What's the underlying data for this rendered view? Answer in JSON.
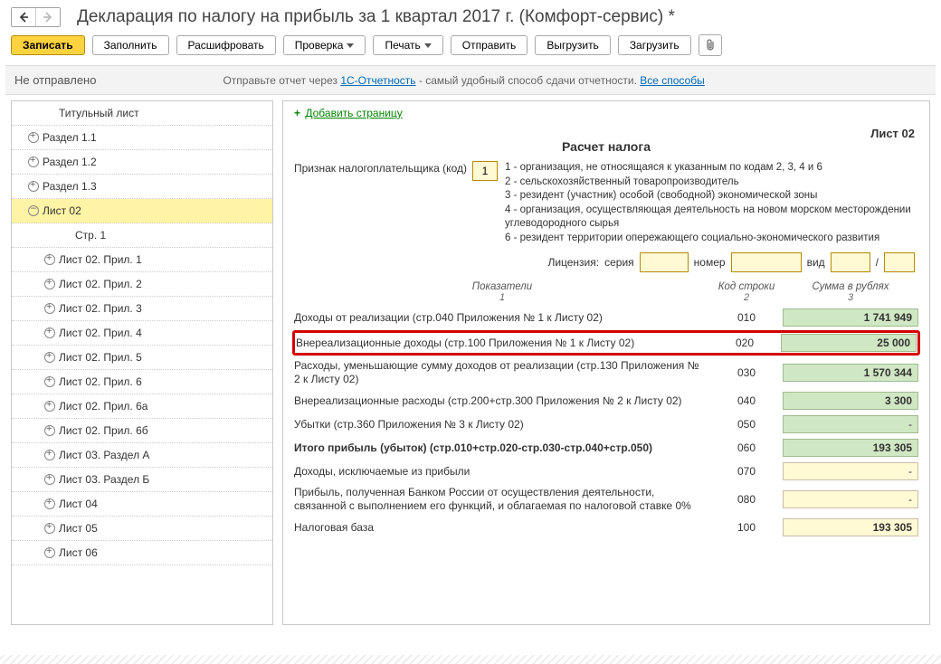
{
  "header": {
    "title": "Декларация по налогу на прибыль за 1 квартал 2017 г. (Комфорт-сервис) *"
  },
  "toolbar": {
    "primary": "Записать",
    "fill": "Заполнить",
    "decode": "Расшифровать",
    "check": "Проверка",
    "print": "Печать",
    "send": "Отправить",
    "export": "Выгрузить",
    "import": "Загрузить"
  },
  "status": {
    "label": "Не отправлено",
    "hint_pre": "Отправьте отчет через ",
    "hint_link1": "1С-Отчетность",
    "hint_mid": " - самый удобный способ сдачи отчетности. ",
    "hint_link2": "Все способы"
  },
  "tree": {
    "items": [
      {
        "label": "Титульный лист",
        "tw": "",
        "lvl": 1
      },
      {
        "label": "Раздел 1.1",
        "tw": "plus",
        "lvl": 0
      },
      {
        "label": "Раздел 1.2",
        "tw": "plus",
        "lvl": 0
      },
      {
        "label": "Раздел 1.3",
        "tw": "plus",
        "lvl": 0
      },
      {
        "label": "Лист 02",
        "tw": "minus",
        "lvl": 0,
        "sel": true
      },
      {
        "label": "Стр. 1",
        "tw": "",
        "lvl": 2
      },
      {
        "label": "Лист 02. Прил. 1",
        "tw": "plus",
        "lvl": 1
      },
      {
        "label": "Лист 02. Прил. 2",
        "tw": "plus",
        "lvl": 1
      },
      {
        "label": "Лист 02. Прил. 3",
        "tw": "plus",
        "lvl": 1
      },
      {
        "label": "Лист 02. Прил. 4",
        "tw": "plus",
        "lvl": 1
      },
      {
        "label": "Лист 02. Прил. 5",
        "tw": "plus",
        "lvl": 1
      },
      {
        "label": "Лист 02. Прил. 6",
        "tw": "plus",
        "lvl": 1
      },
      {
        "label": "Лист 02. Прил. 6а",
        "tw": "plus",
        "lvl": 1
      },
      {
        "label": "Лист 02. Прил. 6б",
        "tw": "plus",
        "lvl": 1
      },
      {
        "label": "Лист 03. Раздел А",
        "tw": "plus",
        "lvl": 1
      },
      {
        "label": "Лист 03. Раздел Б",
        "tw": "plus",
        "lvl": 1
      },
      {
        "label": "Лист 04",
        "tw": "plus",
        "lvl": 1
      },
      {
        "label": "Лист 05",
        "tw": "plus",
        "lvl": 1
      },
      {
        "label": "Лист 06",
        "tw": "plus",
        "lvl": 1
      }
    ]
  },
  "sheet": {
    "add_page": "Добавить страницу",
    "code": "Лист 02",
    "title": "Расчет налога",
    "taxpayer_label": "Признак налогоплательщика (код)",
    "taxpayer_code": "1",
    "codes": [
      "1 - организация, не относящаяся к указанным по кодам 2, 3, 4 и 6",
      "2 - сельскохозяйственный товаропроизводитель",
      "3 - резидент (участник) особой (свободной) экономической зоны",
      "4 - организация, осуществляющая деятельность на новом морском месторождении углеводородного сырья",
      "6 - резидент территории опережающего социально-экономического развития"
    ],
    "license": {
      "label": "Лицензия:",
      "series": "серия",
      "num": "номер",
      "kind": "вид",
      "slash": "/"
    },
    "thead": {
      "c1": "Показатели",
      "c2": "Код строки",
      "c3": "Сумма в рублях",
      "s1": "1",
      "s2": "2",
      "s3": "3"
    },
    "rows": [
      {
        "lab": "Доходы от реализации (стр.040 Приложения № 1 к Листу 02)",
        "code": "010",
        "val": "1 741 949",
        "style": "green bold"
      },
      {
        "lab": "Внереализационные доходы (стр.100 Приложения № 1 к Листу 02)",
        "code": "020",
        "val": "25 000",
        "style": "green bold",
        "hl": true
      },
      {
        "lab": "Расходы, уменьшающие сумму доходов от реализации (стр.130 Приложения № 2 к Листу 02)",
        "code": "030",
        "val": "1 570 344",
        "style": "green bold"
      },
      {
        "lab": "Внереализационные расходы (стр.200+стр.300 Приложения № 2 к Листу 02)",
        "code": "040",
        "val": "3 300",
        "style": "green bold"
      },
      {
        "lab": "Убытки (стр.360 Приложения № 3 к Листу 02)",
        "code": "050",
        "val": "-",
        "style": "green"
      },
      {
        "lab": "Итого прибыль (убыток)  (cтр.010+стр.020-стр.030-стр.040+стр.050)",
        "code": "060",
        "val": "193 305",
        "style": "green bold",
        "bold": true
      },
      {
        "lab": "Доходы, исключаемые из прибыли",
        "code": "070",
        "val": "-",
        "style": "yellow"
      },
      {
        "lab": "Прибыль, полученная Банком России от осуществления деятельности, связанной с выполнением его функций, и облагаемая по налоговой ставке 0%",
        "code": "080",
        "val": "-",
        "style": "yellow"
      },
      {
        "lab": "Налоговая база",
        "code": "100",
        "val": "193 305",
        "style": "yellow bold"
      }
    ]
  }
}
